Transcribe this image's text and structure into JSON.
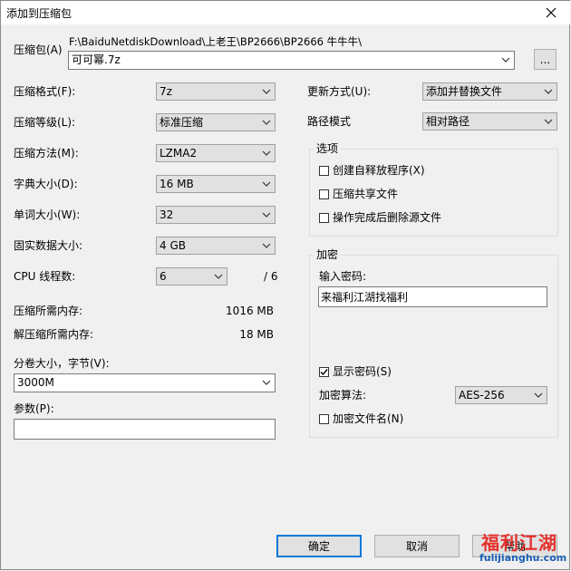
{
  "window": {
    "title": "添加到压缩包",
    "close_icon": "close-icon"
  },
  "archive": {
    "label": "压缩包(A)",
    "path": "F:\\BaiduNetdiskDownload\\上老王\\BP2666\\BP2666 牛牛牛\\",
    "filename": "可可幂.7z",
    "browse_label": "..."
  },
  "left": {
    "format": {
      "label": "压缩格式(F):",
      "value": "7z"
    },
    "level": {
      "label": "压缩等级(L):",
      "value": "标准压缩"
    },
    "method": {
      "label": "压缩方法(M):",
      "value": "LZMA2"
    },
    "dict": {
      "label": "字典大小(D):",
      "value": "16 MB"
    },
    "word": {
      "label": "单词大小(W):",
      "value": "32"
    },
    "solid": {
      "label": "固实数据大小:",
      "value": "4 GB"
    },
    "threads": {
      "label": "CPU 线程数:",
      "value": "6",
      "max": "/ 6"
    },
    "mem_compress": {
      "label": "压缩所需内存:",
      "value": "1016 MB"
    },
    "mem_decompress": {
      "label": "解压缩所需内存:",
      "value": "18 MB"
    },
    "volume": {
      "label": "分卷大小，字节(V):",
      "value": "3000M"
    },
    "params": {
      "label": "参数(P):",
      "value": ""
    }
  },
  "right": {
    "update": {
      "label": "更新方式(U):",
      "value": "添加并替换文件"
    },
    "pathmode": {
      "label": "路径模式",
      "value": "相对路径"
    },
    "options": {
      "title": "选项",
      "sfx": {
        "label": "创建自释放程序(X)",
        "checked": false
      },
      "shared": {
        "label": "压缩共享文件",
        "checked": false
      },
      "delete": {
        "label": "操作完成后删除源文件",
        "checked": false
      }
    },
    "encryption": {
      "title": "加密",
      "password_label": "输入密码:",
      "password": "来福利江湖找福利",
      "show_password": {
        "label": "显示密码(S)",
        "checked": true
      },
      "method_label": "加密算法:",
      "method_value": "AES-256",
      "encrypt_names": {
        "label": "加密文件名(N)",
        "checked": false
      }
    }
  },
  "buttons": {
    "ok": "确定",
    "cancel": "取消",
    "help": "帮助"
  },
  "watermark": {
    "big": "福利江湖",
    "url": "fulijianghu.com"
  }
}
